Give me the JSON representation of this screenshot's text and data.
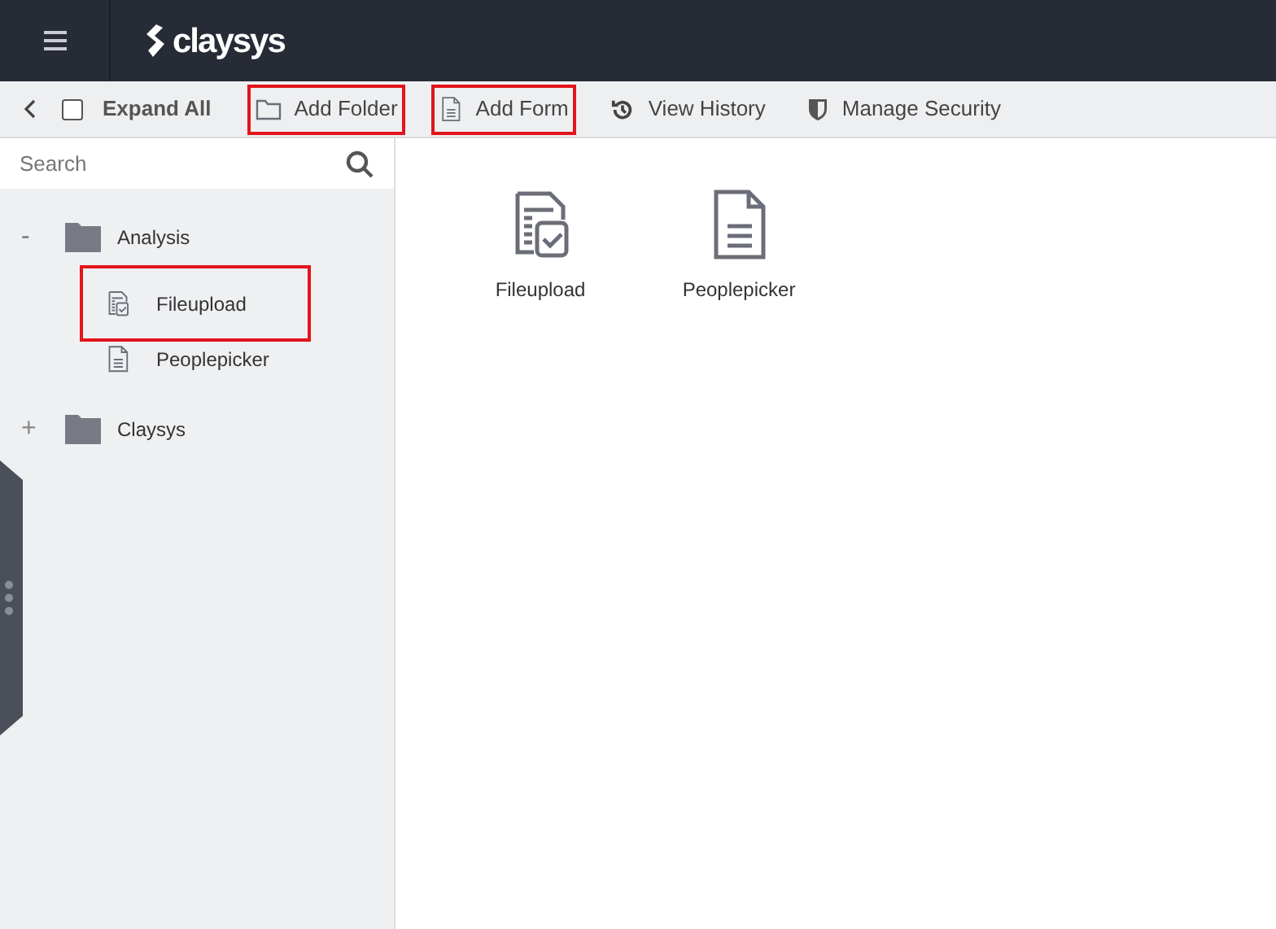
{
  "header": {
    "logo": "claysys"
  },
  "toolbar": {
    "expand_all": {
      "label": "Expand All",
      "checked": false
    },
    "buttons": [
      {
        "kind": "folder",
        "label": "Add Folder",
        "highlighted": true
      },
      {
        "kind": "form",
        "label": "Add Form",
        "highlighted": true
      },
      {
        "kind": "history",
        "label": "View History",
        "highlighted": false
      },
      {
        "kind": "security",
        "label": "Manage Security",
        "highlighted": false
      }
    ]
  },
  "search": {
    "placeholder": "Search"
  },
  "tree": [
    {
      "label": "Analysis",
      "toggle": "-",
      "expanded": true,
      "children": [
        {
          "kind": "upload",
          "label": "Fileupload",
          "highlighted": true
        },
        {
          "kind": "form",
          "label": "Peoplepicker",
          "highlighted": false
        }
      ]
    },
    {
      "label": "Claysys",
      "toggle": "+",
      "expanded": false
    }
  ],
  "forms": [
    {
      "kind": "upload",
      "label": "Fileupload"
    },
    {
      "kind": "form",
      "label": "Peoplepicker"
    }
  ]
}
